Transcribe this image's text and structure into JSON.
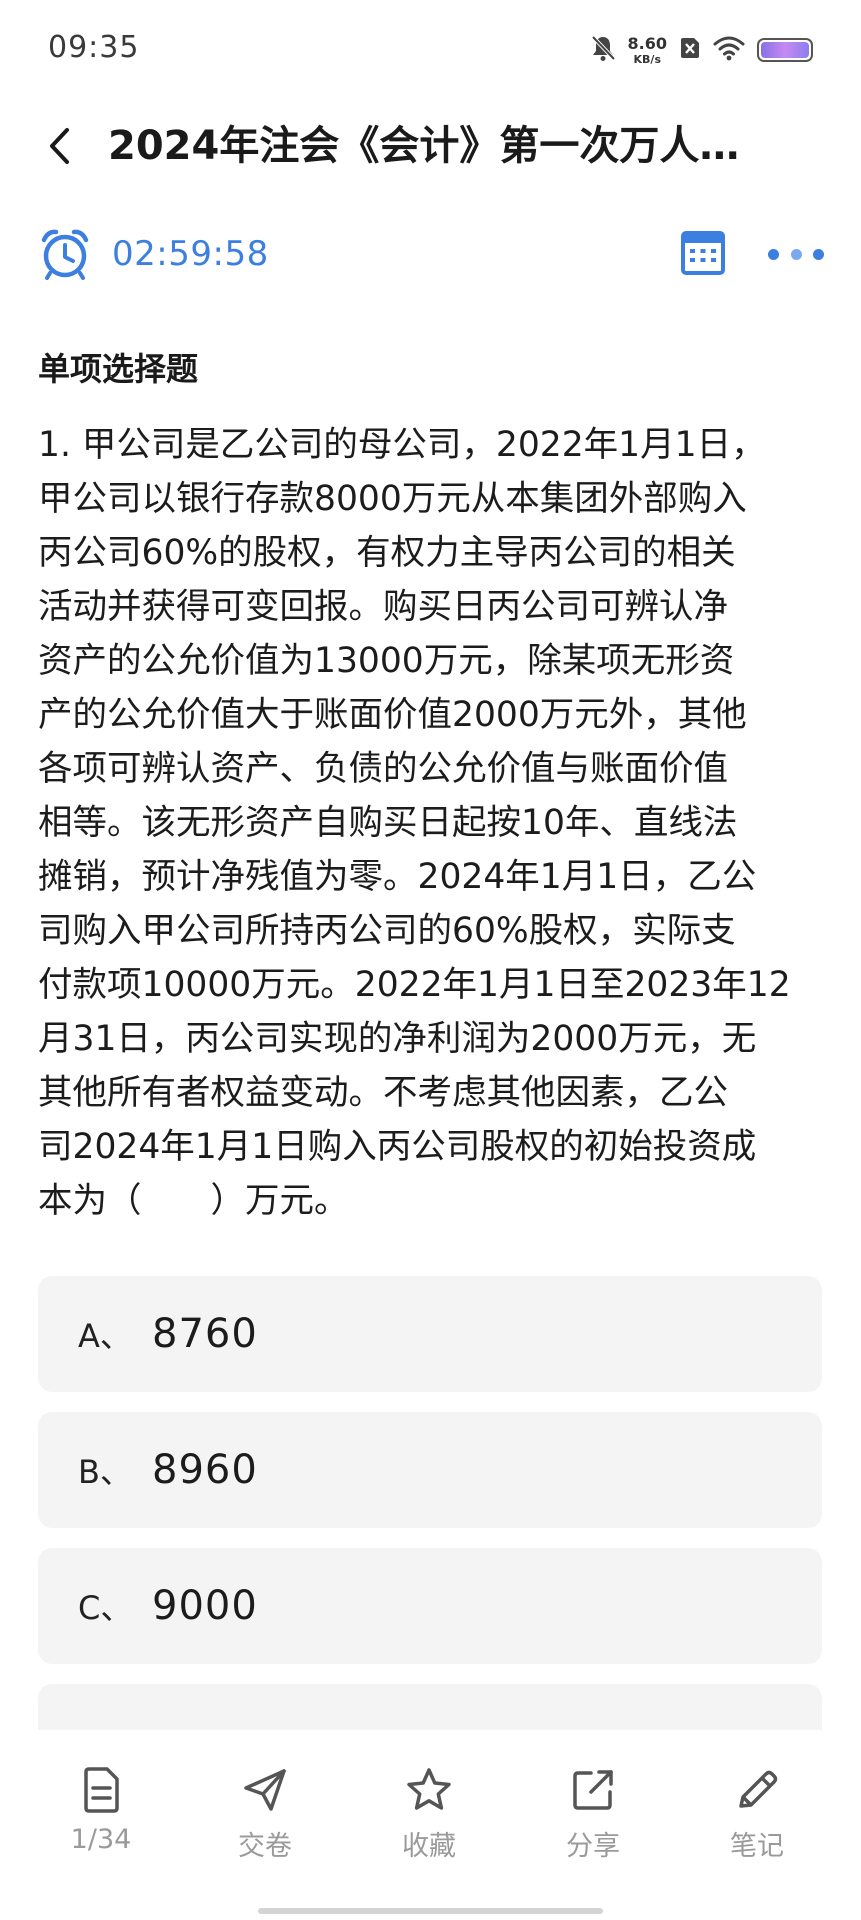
{
  "status_bar": {
    "time": "09:35",
    "net_speed_value": "8.60",
    "net_speed_unit": "KB/s",
    "icons": [
      "bell-off-icon",
      "sim-x-icon",
      "wifi-icon",
      "battery-icon"
    ]
  },
  "header": {
    "title": "2024年注会《会计》第一次万人…",
    "back_icon": "chevron-left-icon"
  },
  "timer": {
    "value": "02:59:58",
    "icon": "alarm-clock-icon",
    "accent_color": "#3d7fe0"
  },
  "question": {
    "section_title": "单项选择题",
    "lines": [
      "1. 甲公司是乙公司的母公司，2022年1月1日，",
      "甲公司以银行存款8000万元从本集团外部购入",
      "丙公司60%的股权，有权力主导丙公司的相关",
      "活动并获得可变回报。购买日丙公司可辨认净",
      "资产的公允价值为13000万元，除某项无形资",
      "产的公允价值大于账面价值2000万元外，其他",
      "各项可辨认资产、负债的公允价值与账面价值",
      "相等。该无形资产自购买日起按10年、直线法",
      "摊销，预计净残值为零。2024年1月1日，乙公",
      "司购入甲公司所持丙公司的60%股权，实际支",
      "付款项10000万元。2022年1月1日至2023年12",
      "月31日，丙公司实现的净利润为2000万元，无",
      "其他所有者权益变动。不考虑其他因素，乙公",
      "司2024年1月1日购入丙公司股权的初始投资成",
      "本为（　　）万元。"
    ]
  },
  "options": [
    {
      "letter": "A、",
      "value": "8760"
    },
    {
      "letter": "B、",
      "value": "8960"
    },
    {
      "letter": "C、",
      "value": "9000"
    }
  ],
  "bottom_nav": [
    {
      "label": "1/34",
      "icon": "document-icon"
    },
    {
      "label": "交卷",
      "icon": "send-icon"
    },
    {
      "label": "收藏",
      "icon": "star-icon"
    },
    {
      "label": "分享",
      "icon": "share-icon"
    },
    {
      "label": "笔记",
      "icon": "pencil-icon"
    }
  ]
}
